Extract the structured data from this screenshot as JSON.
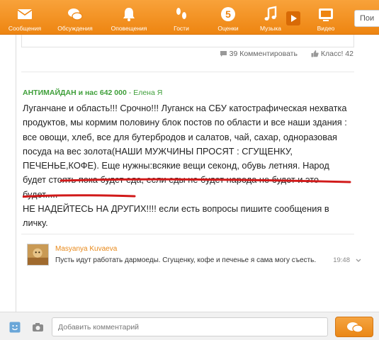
{
  "nav": {
    "items": [
      {
        "label": "Сообщения",
        "icon": "envelope-icon"
      },
      {
        "label": "Обсуждения",
        "icon": "chat-bubbles-icon"
      },
      {
        "label": "Оповещения",
        "icon": "bell-icon"
      },
      {
        "label": "Гости",
        "icon": "footprints-icon"
      },
      {
        "label": "Оценки",
        "icon": "rating-5-icon",
        "badge": "5"
      },
      {
        "label": "Музыка",
        "icon": "music-note-icon"
      },
      {
        "label": "Видео",
        "icon": "tv-icon"
      }
    ],
    "search_placeholder": "Пои"
  },
  "post": {
    "actions": {
      "comments": "39 Комментировать",
      "likes": "Класс! 42"
    },
    "group": "АНТИМАЙДАН и нас 642 000",
    "separator": " - ",
    "author": "Елена Я",
    "paragraph_1": "Луганчане и область!!! Срочно!!! Луганск на СБУ катострафическая нехватка  продуктов, мы кормим половину блок постов по области и все наши здания : все овощи, хлеб, все для бутербродов и салатов, чай, сахар, одноразовая посуда на вес золота(НАШИ МУЖЧИНЫ ПРОСЯТ : СГУЩЕНКУ, ПЕЧЕНЬЕ,КОФЕ). Еще нужны:всякие вещи секонд, обувь летняя.  Народ будет стоять пока будет еда, если еды не будет народа не будет и это будет.....",
    "paragraph_2": " НЕ  НАДЕЙТЕСЬ НА ДРУГИХ!!!! если есть вопросы пишите сообщения в личку."
  },
  "comment": {
    "author": "Masyanya Kuvaeva",
    "text": "Пусть идут работать дармоеды. Сгущенку, кофе и печенье я сама могу съесть.",
    "time": "19:48"
  },
  "composer": {
    "placeholder": "Добавить комментарий"
  },
  "colors": {
    "brand": "#ee8511",
    "group_link": "#3f9f3a",
    "underline": "#d11a1a",
    "comment_author": "#e8891a"
  }
}
